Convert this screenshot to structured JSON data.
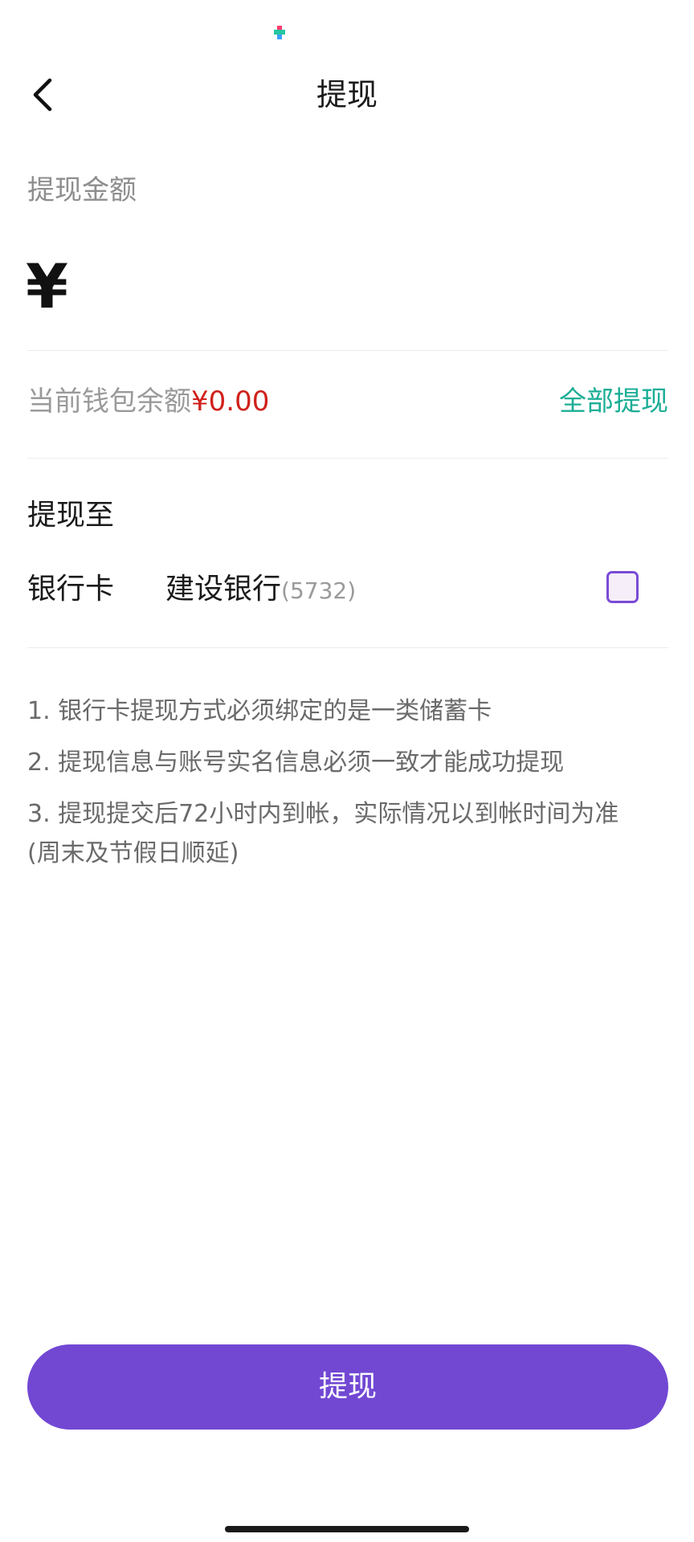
{
  "header": {
    "title": "提现"
  },
  "amount": {
    "label": "提现金额",
    "currency_symbol": "¥",
    "input_value": ""
  },
  "balance": {
    "prefix": "当前钱包余额",
    "amount": "¥0.00",
    "withdraw_all": "全部提现"
  },
  "destination": {
    "label": "提现至",
    "method": "银行卡",
    "bank_name": "建设银行",
    "card_tail": "(5732)",
    "selected": false
  },
  "notes": [
    "1. 银行卡提现方式必须绑定的是一类储蓄卡",
    "2. 提现信息与账号实名信息必须一致才能成功提现",
    "3. 提现提交后72小时内到帐，实际情况以到帐时间为准",
    "(周末及节假日顺延)"
  ],
  "submit": {
    "label": "提现"
  },
  "colors": {
    "accent_purple": "#7248d3",
    "balance_red": "#d0201b",
    "link_teal": "#1cae96",
    "checkbox_border": "#7b4bd6"
  },
  "icons": {
    "back": "chevron-left-icon",
    "status": "app-notification-icon"
  }
}
